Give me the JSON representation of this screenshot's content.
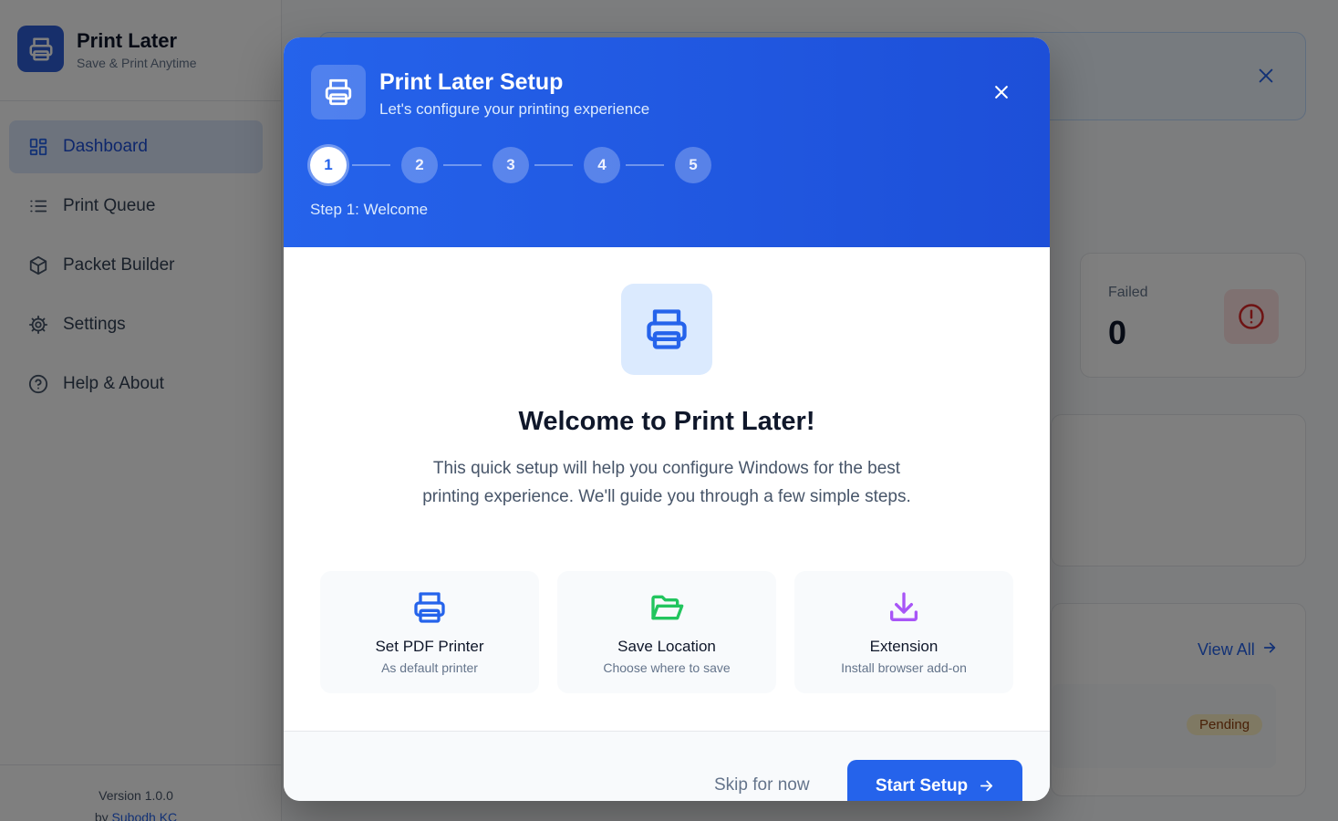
{
  "app": {
    "title": "Print Later",
    "subtitle": "Save & Print Anytime"
  },
  "sidebar": {
    "items": [
      {
        "label": "Dashboard",
        "icon": "dashboard-grid-icon",
        "active": true
      },
      {
        "label": "Print Queue",
        "icon": "list-icon",
        "active": false
      },
      {
        "label": "Packet Builder",
        "icon": "package-icon",
        "active": false
      },
      {
        "label": "Settings",
        "icon": "gear-icon",
        "active": false
      },
      {
        "label": "Help & About",
        "icon": "help-circle-icon",
        "active": false
      }
    ],
    "version": "Version 1.0.0",
    "author_prefix": "by ",
    "author": "Subodh KC"
  },
  "background": {
    "failed_label": "Failed",
    "failed_value": "0",
    "view_all": "View All",
    "pending_badge": "Pending"
  },
  "modal": {
    "title": "Print Later Setup",
    "subtitle": "Let's configure your printing experience",
    "steps": [
      "1",
      "2",
      "3",
      "4",
      "5"
    ],
    "current_step": 1,
    "step_caption": "Step 1: Welcome",
    "welcome_title": "Welcome to Print Later!",
    "welcome_text": "This quick setup will help you configure Windows for the best printing experience. We'll guide you through a few simple steps.",
    "features": [
      {
        "title": "Set PDF Printer",
        "subtitle": "As default printer",
        "icon": "printer-icon",
        "color": "#2563eb"
      },
      {
        "title": "Save Location",
        "subtitle": "Choose where to save",
        "icon": "folder-open-icon",
        "color": "#22c55e"
      },
      {
        "title": "Extension",
        "subtitle": "Install browser add-on",
        "icon": "download-icon",
        "color": "#a855f7"
      }
    ],
    "skip_label": "Skip for now",
    "start_label": "Start Setup"
  },
  "colors": {
    "primary": "#2563eb",
    "sidebar_active_bg": "#dbe7fb",
    "overlay": "rgba(0,0,0,0.5)"
  }
}
